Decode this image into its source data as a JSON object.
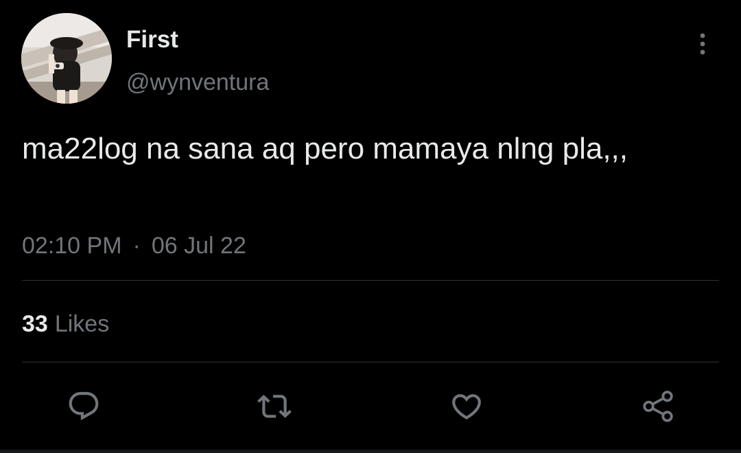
{
  "tweet": {
    "display_name": "First",
    "handle": "@wynventura",
    "text": "ma22log na sana aq pero mamaya nlng pla,,,",
    "time": "02:10 PM",
    "separator": "·",
    "date": "06 Jul 22",
    "likes_count": "33",
    "likes_label": "Likes"
  },
  "icons": {
    "more": "more-vertical-icon",
    "reply": "reply-icon",
    "retweet": "retweet-icon",
    "like": "heart-icon",
    "share": "share-icon"
  },
  "colors": {
    "background": "#000000",
    "primary_text": "#e7e9ea",
    "secondary_text": "#71767b",
    "divider": "#2f3336"
  }
}
